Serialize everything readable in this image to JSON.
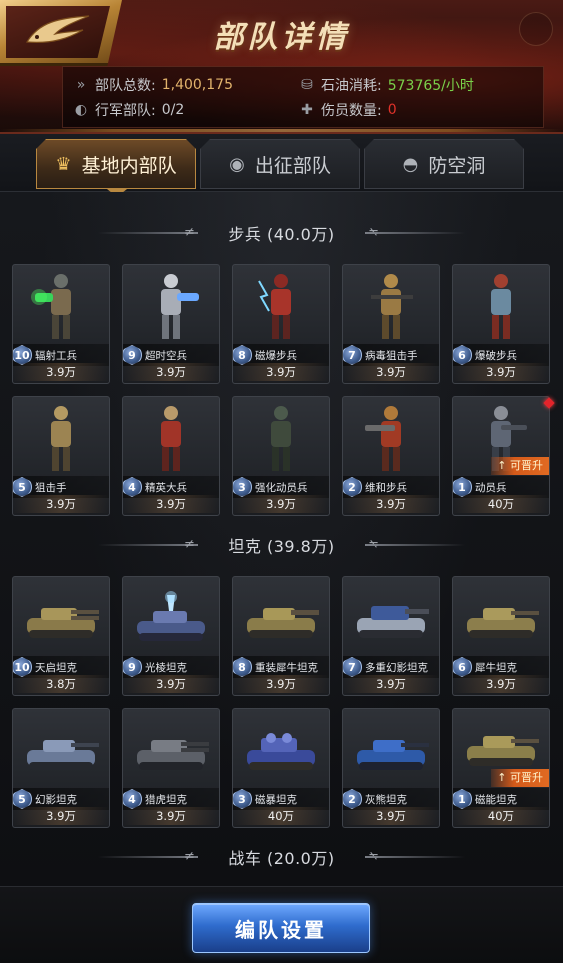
{
  "header": {
    "title": "部队详情"
  },
  "stats": {
    "total_label": "部队总数:",
    "total_value": "1,400,175",
    "oil_label": "石油消耗:",
    "oil_value": "573765/小时",
    "march_label": "行军部队:",
    "march_value": "0/2",
    "wounded_label": "伤员数量:",
    "wounded_value": "0"
  },
  "tabs": [
    {
      "label": "基地内部队",
      "icon": "crown-icon",
      "active": true
    },
    {
      "label": "出征部队",
      "icon": "helmet-icon",
      "active": false
    },
    {
      "label": "防空洞",
      "icon": "shelter-icon",
      "active": false
    }
  ],
  "sections": [
    {
      "title": "步兵 (40.0万)",
      "units": [
        {
          "level": "10",
          "name": "辐射工兵",
          "count": "3.9万"
        },
        {
          "level": "9",
          "name": "超时空兵",
          "count": "3.9万"
        },
        {
          "level": "8",
          "name": "磁爆步兵",
          "count": "3.9万"
        },
        {
          "level": "7",
          "name": "病毒狙击手",
          "count": "3.9万"
        },
        {
          "level": "6",
          "name": "爆破步兵",
          "count": "3.9万"
        },
        {
          "level": "5",
          "name": "狙击手",
          "count": "3.9万"
        },
        {
          "level": "4",
          "name": "精英大兵",
          "count": "3.9万"
        },
        {
          "level": "3",
          "name": "强化动员兵",
          "count": "3.9万"
        },
        {
          "level": "2",
          "name": "维和步兵",
          "count": "3.9万"
        },
        {
          "level": "1",
          "name": "动员兵",
          "count": "40万",
          "upgrade": "可晋升"
        }
      ]
    },
    {
      "title": "坦克 (39.8万)",
      "units": [
        {
          "level": "10",
          "name": "天启坦克",
          "count": "3.8万"
        },
        {
          "level": "9",
          "name": "光棱坦克",
          "count": "3.9万"
        },
        {
          "level": "8",
          "name": "重装犀牛坦克",
          "count": "3.9万"
        },
        {
          "level": "7",
          "name": "多重幻影坦克",
          "count": "3.9万"
        },
        {
          "level": "6",
          "name": "犀牛坦克",
          "count": "3.9万"
        },
        {
          "level": "5",
          "name": "幻影坦克",
          "count": "3.9万"
        },
        {
          "level": "4",
          "name": "猎虎坦克",
          "count": "3.9万"
        },
        {
          "level": "3",
          "name": "磁暴坦克",
          "count": "40万"
        },
        {
          "level": "2",
          "name": "灰熊坦克",
          "count": "3.9万"
        },
        {
          "level": "1",
          "name": "磁能坦克",
          "count": "40万",
          "upgrade": "可晋升"
        }
      ]
    },
    {
      "title": "战车 (20.0万)",
      "units": []
    }
  ],
  "footer": {
    "button_label": "编队设置"
  },
  "colors": {
    "accent_gold": "#e2b36c",
    "oil_green": "#7ad14a",
    "wounded_red": "#e0322a",
    "button_blue": "#2f6ccd"
  }
}
